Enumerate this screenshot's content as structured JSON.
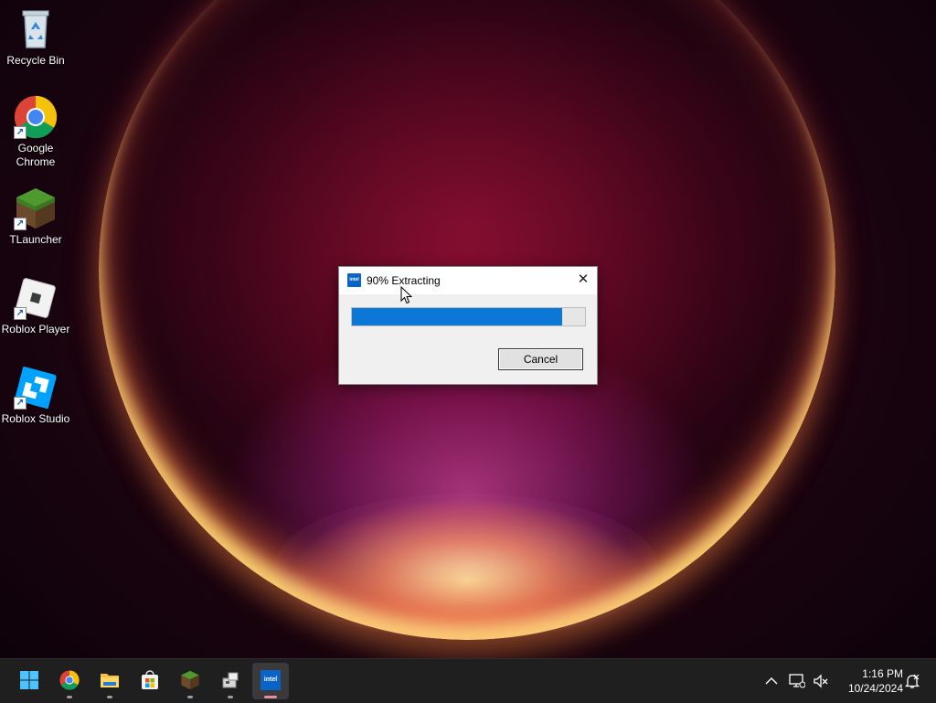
{
  "desktop": {
    "icons": [
      {
        "label": "Recycle Bin",
        "icon": "recycle-bin-icon"
      },
      {
        "label": "Google Chrome",
        "icon": "chrome-icon"
      },
      {
        "label": "TLauncher",
        "icon": "tlauncher-icon"
      },
      {
        "label": "Roblox Player",
        "icon": "roblox-player-icon"
      },
      {
        "label": "Roblox Studio",
        "icon": "roblox-studio-icon"
      }
    ]
  },
  "dialog": {
    "title": "90% Extracting",
    "app_icon_text": "intel",
    "close_glyph": "✕",
    "progress_percent": 90,
    "cancel_label": "Cancel"
  },
  "taskbar": {
    "apps": [
      {
        "name": "start",
        "icon": "windows-start-icon"
      },
      {
        "name": "chrome",
        "icon": "chrome-icon"
      },
      {
        "name": "file-explorer",
        "icon": "folder-icon"
      },
      {
        "name": "microsoft-store",
        "icon": "store-icon"
      },
      {
        "name": "tlauncher",
        "icon": "tlauncher-icon"
      },
      {
        "name": "installer",
        "icon": "installer-icon"
      },
      {
        "name": "intel",
        "icon": "intel-icon",
        "active": true
      }
    ],
    "intel_label": "intel",
    "tray": {
      "chevron": "^",
      "time": "1:16 PM",
      "date": "10/24/2024"
    }
  },
  "colors": {
    "accent": "#0b78d7",
    "taskbar": "#1f1f1f",
    "intel_blue": "#0a64c8"
  }
}
